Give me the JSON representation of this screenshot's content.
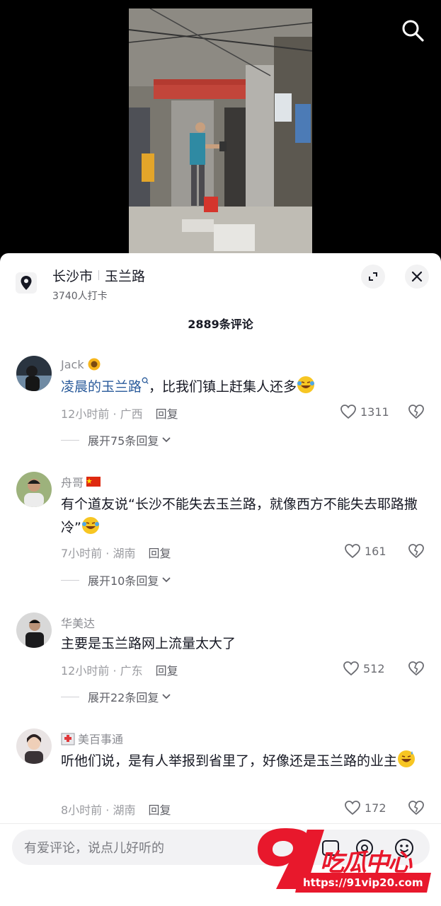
{
  "location": {
    "city": "长沙市",
    "road": "玉兰路",
    "checkins": "3740人打卡"
  },
  "comments_header": "2889条评论",
  "comments": [
    {
      "user": "Jack",
      "user_badge": "sunflower-emoji",
      "text_link": "凌晨的玉兰路",
      "text": "，比我们镇上赶集人还多",
      "time_region": "12小时前 · 广西",
      "reply_label": "回复",
      "likes": "1311",
      "expand": "展开75条回复"
    },
    {
      "user": "舟哥",
      "user_badge": "china-flag",
      "text": "有个道友说“长沙不能失去玉兰路，就像西方不能失去耶路撒冷”",
      "time_region": "7小时前 · 湖南",
      "reply_label": "回复",
      "likes": "161",
      "expand": "展开10条回复"
    },
    {
      "user": "华美达",
      "text": "主要是玉兰路网上流量太大了",
      "time_region": "12小时前 · 广东",
      "reply_label": "回复",
      "likes": "512",
      "expand": "展开22条回复"
    },
    {
      "user": "美百事通",
      "user_badge": "hospital-emoji",
      "text": "听他们说，是有人举报到省里了，好像还是玉兰路的业主",
      "time_region": "8小时前 · 湖南",
      "reply_label": "回复",
      "likes": "172"
    }
  ],
  "input": {
    "placeholder": "有爱评论，说点儿好听的"
  },
  "watermark": {
    "logo_text": "91吃瓜中心",
    "url": "https://91vip20.com"
  },
  "colors": {
    "link": "#2a5b9b",
    "watermark_red": "#e8182c",
    "sheet_bg": "#ffffff"
  }
}
